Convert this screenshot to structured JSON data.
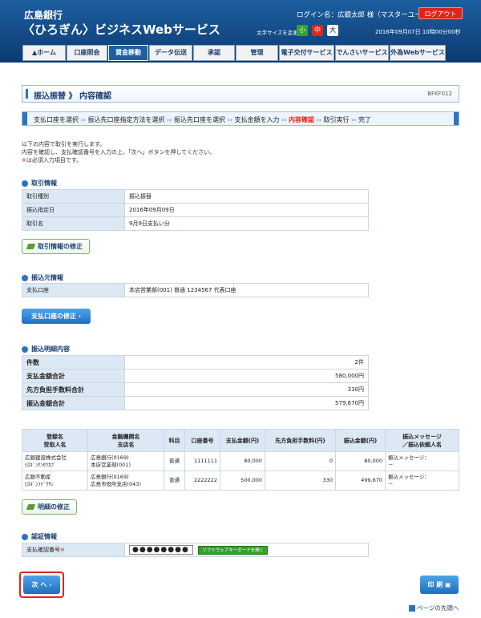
{
  "header": {
    "bank_name": "広島銀行",
    "service_name": "〈ひろぎん〉ビジネスWebサービス",
    "login_text": "ログイン名：広銀太郎 様（マスターユーザ）",
    "logout_label": "ログアウト",
    "font_size_label": "文字サイズを変更",
    "font_small": "小",
    "font_medium": "中",
    "font_large": "大",
    "datetime": "2016年09月07日 10時00分00秒"
  },
  "nav": [
    {
      "label": "ホーム"
    },
    {
      "label": "口座照会"
    },
    {
      "label": "資金移動"
    },
    {
      "label": "データ伝送"
    },
    {
      "label": "承認"
    },
    {
      "label": "管理"
    },
    {
      "label": "電子交付サービス"
    },
    {
      "label": "でんさいサービス"
    },
    {
      "label": "外為Webサービス"
    }
  ],
  "page": {
    "title": "振込振替 》 内容確認",
    "screen_code": "BFKF012"
  },
  "steps": [
    "支払口座を選択",
    "振込先口座指定方法を選択",
    "振込先口座を選択",
    "支払金額を入力",
    "内容確認",
    "取引実行",
    "完了"
  ],
  "intro": {
    "line1": "以下の内容で取引を実行します。",
    "line2": "内容を確認し、支払確認番号を入力の上、「次へ」ボタンを押してください。",
    "line3_mark": "※",
    "line3": "は必須入力項目です。"
  },
  "transaction_info": {
    "heading": "取引情報",
    "rows": [
      {
        "label": "取引種別",
        "value": "振込振替"
      },
      {
        "label": "振込指定日",
        "value": "2016年09月09日"
      },
      {
        "label": "取引名",
        "value": "9月9日支払い分"
      }
    ],
    "edit_button": "取引情報の修正"
  },
  "source_info": {
    "heading": "振込元情報",
    "label": "支払口座",
    "value": "本店営業部(001) 普通 1234567 代表口座",
    "edit_button": "支払口座の修正"
  },
  "summary": {
    "heading": "振込明細内容",
    "rows": [
      {
        "label": "件数",
        "value": "2件"
      },
      {
        "label": "支払金額合計",
        "value": "580,000円"
      },
      {
        "label": "先方負担手数料合計",
        "value": "330円"
      },
      {
        "label": "振込金額合計",
        "value": "579,670円"
      }
    ]
  },
  "detail": {
    "headers": {
      "payee_l1": "登録名",
      "payee_l2": "受取人名",
      "bank_l1": "金融機関名",
      "bank_l2": "支店名",
      "item": "科目",
      "account": "口座番号",
      "pay_amount": "支払金額(円)",
      "fee": "先方負担手数料(円)",
      "transfer": "振込金額(円)",
      "msg_l1": "振込メッセージ",
      "msg_l2": "／振込依頼人名"
    },
    "rows": [
      {
        "name": "広銀建設株式会社",
        "kana": "ﾋﾛｷﾞﾝｹﾝｾﾂｶﾌﾞ",
        "bank": "広島銀行(0169)",
        "branch": "本店営業部(001)",
        "item": "普通",
        "account": "1111111",
        "pay": "80,000",
        "fee": "0",
        "transfer": "80,000",
        "msg": "振込メッセージ：",
        "msg2": "－"
      },
      {
        "name": "広銀不動産",
        "kana": "ﾋﾛｷﾞﾝﾌﾄﾞｳｻﾝ",
        "bank": "広島銀行(0169)",
        "branch": "広島市役所支店(043)",
        "item": "普通",
        "account": "2222222",
        "pay": "500,000",
        "fee": "330",
        "transfer": "499,670",
        "msg": "振込メッセージ：",
        "msg2": "－"
      }
    ],
    "edit_button": "明細の修正"
  },
  "auth": {
    "heading": "認証情報",
    "label": "支払確認番号",
    "req_mark": "※",
    "password_mask": "●●●●●●●●",
    "soft_keyboard": "ソフトウェアキーボードを開く"
  },
  "footer": {
    "next_button": "次 へ",
    "print_button": "印 刷",
    "page_top": "ページの先頭へ"
  },
  "colors": {
    "header_blue": "#1d5fa0",
    "accent_red": "#e2231a",
    "green": "#33a12c"
  }
}
